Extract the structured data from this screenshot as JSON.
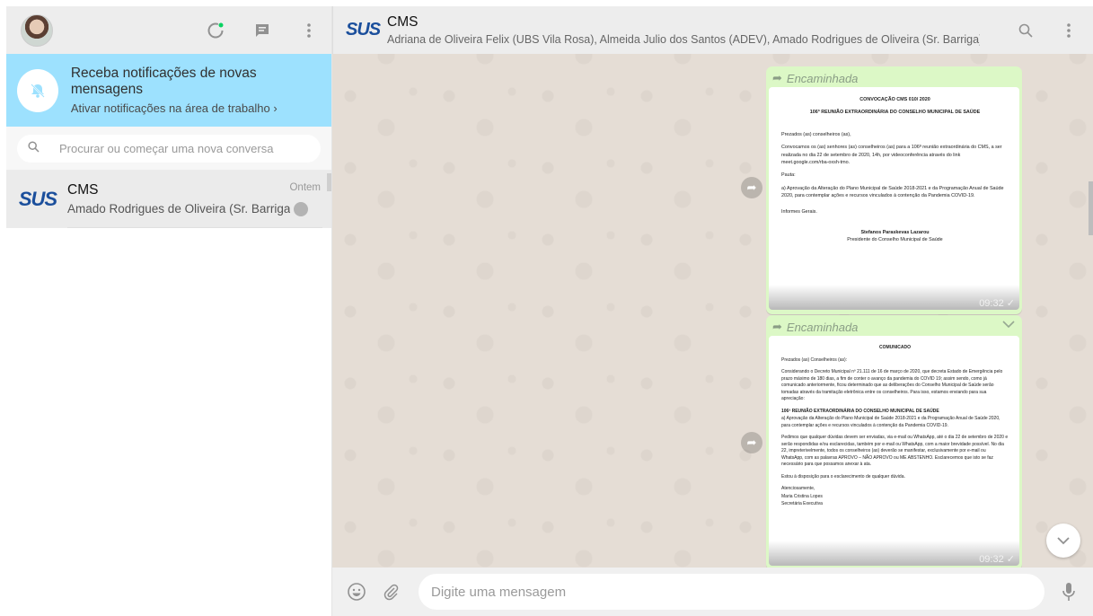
{
  "sidebar": {
    "header": {
      "avatar_alt": "",
      "icons": [
        "status-icon",
        "new-chat-icon",
        "menu-icon"
      ]
    },
    "notification": {
      "title": "Receba notificações de novas mensagens",
      "link": "Ativar notificações na área de trabalho ›"
    },
    "search": {
      "placeholder": "Procurar ou começar uma nova conversa"
    },
    "chats": [
      {
        "avatar_text": "SUS",
        "name": "CMS",
        "time": "Ontem",
        "last_message": "Amado Rodrigues de Oliveira (Sr. Barriga) (UBS Ipê"
      }
    ]
  },
  "conversation": {
    "header": {
      "logo_text": "SUS",
      "title": "CMS",
      "participants": "Adriana de Oliveira Felix (UBS Vila Rosa), Almeida Julio dos Santos (ADEV), Amado Rodrigues de Oliveira (Sr. Barriga) (UBS Ipê), Anderson Fr..."
    },
    "messages": [
      {
        "forwarded_label": "Encaminhada",
        "time": "09:32 ✓",
        "doc": {
          "heading1": "CONVOCAÇÃO CMS 010/ 2020",
          "heading2": "106ª REUNIÃO EXTRAORDINÁRIA DO CONSELHO MUNICIPAL DE SAÚDE",
          "greeting": "Prezados (as) conselheiros (as),",
          "body": "Convocamos os (as) senhores (as) conselheiros (as) para a 106ª reunião extraordinária do CMS, a ser realizada no dia 22 de setembro de 2020, 14h, por videoconferência através do link meet.google.com/rba-oxsh-tmo.",
          "pauta": "Pauta:",
          "item": "a)  Aprovação da Alteração do Plano Municipal de Saúde 2018-2021 e da Programação Anual de Saúde 2020, para contemplar ações e recursos vinculados à contenção da Pandemia COVID-19.",
          "informes": "Informes Gerais.",
          "signature_name": "Stefanos Paraskevas Lazarou",
          "signature_role": "Presidente do Conselho Municipal de Saúde"
        }
      },
      {
        "forwarded_label": "Encaminhada",
        "time": "09:32 ✓",
        "doc": {
          "heading1": "COMUNICADO",
          "greeting": "Prezados (as) Conselheiros (as):",
          "body": "Considerando o Decreto Municipal nº 21.111 de 16 de março de 2020, que decreta Estado de Emergência pelo prazo máximo de 180 dias, a fim de conter o avanço da pandemia do COVID 19; assim sendo, como já comunicado anteriormente, ficou determinado que as deliberações do Conselho Municipal de Saúde serão tomadas através da tramitação eletrônica entre os conselheiros. Para isso, estamos enviando para sua apreciação:",
          "heading2": "106ª REUNIÃO EXTRAORDINÁRIA DO CONSELHO MUNICIPAL DE SAÚDE",
          "item": "a)  Aprovação da Alteração do Plano Municipal de Saúde 2018-2021 e da Programação Anual de Saúde 2020, para contemplar ações e recursos vinculados à contenção da Pandemia COVID-19.",
          "body2": "Pedimos que qualquer dúvidas devem ser enviadas, via e-mail ou WhatsApp, até o dia 22 de setembro de 2020 e serão respondidas e/ou esclarecidas, também por e-mail ou WhatsApp, com a maior brevidade possível. No dia 22, impreterivelmente, todos os conselheiros (as) deverão se manifestar, exclusivamente por e-mail ou WhatsApp, com as palavras APROVO – NÃO APROVO ou ME ABSTENHO. Esclarecemos que isto se faz necessário para que possamos anexar à ata.",
          "body3": "Estou à disposição para o esclarecimento de qualquer dúvida.",
          "closing": "Atenciosamente,",
          "signature_name": "Maria Cristina Lopes",
          "signature_role": "Secretária Executiva"
        }
      }
    ],
    "composer": {
      "placeholder": "Digite uma mensagem"
    }
  }
}
